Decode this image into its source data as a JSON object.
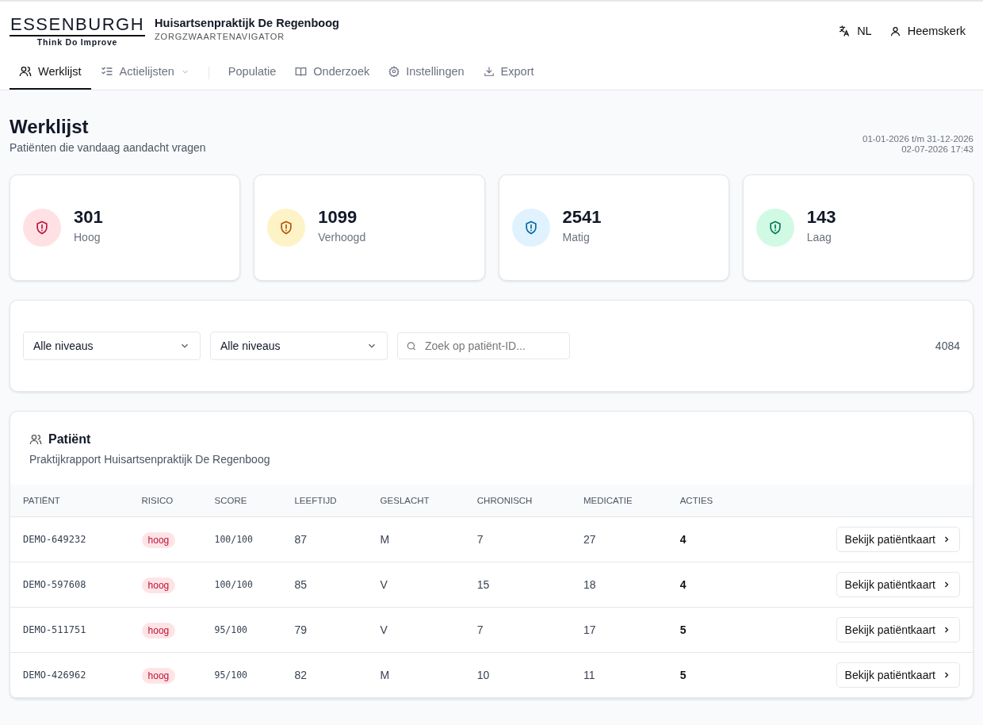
{
  "brand": {
    "logo": "ESSENBURGH",
    "tagline": "Think Do Improve",
    "practice": "Huisartsenpraktijk De Regenboog",
    "app": "ZORGZWAARTENAVIGATOR"
  },
  "header_actions": {
    "language": "NL",
    "user": "Heemskerk"
  },
  "tabs": [
    {
      "label": "Werklijst",
      "selected": true,
      "has_menu": false
    },
    {
      "label": "Actielijsten",
      "selected": false,
      "has_menu": true
    },
    {
      "label": "Populatie",
      "selected": false,
      "has_menu": false
    },
    {
      "label": "Onderzoek",
      "selected": false,
      "has_menu": false
    },
    {
      "label": "Instellingen",
      "selected": false,
      "has_menu": false
    },
    {
      "label": "Export",
      "selected": false,
      "has_menu": false
    }
  ],
  "page": {
    "title": "Werklijst",
    "subtitle": "Patiënten die vandaag aandacht vragen",
    "period": "01-01-2026 t/m 31-12-2026",
    "updated": "02-07-2026 17:43"
  },
  "stats": [
    {
      "value": "301",
      "label": "Hoog",
      "kind": "high"
    },
    {
      "value": "1099",
      "label": "Verhoogd",
      "kind": "elevated"
    },
    {
      "value": "2541",
      "label": "Matig",
      "kind": "moderate"
    },
    {
      "value": "143",
      "label": "Laag",
      "kind": "low"
    }
  ],
  "filters": {
    "selects": [
      "Alle niveaus",
      "Alle niveaus"
    ],
    "search": {
      "placeholder": "Zoek op patiënt-ID..."
    },
    "count": "4084"
  },
  "table": {
    "title": "Patiënt",
    "subtitle": "Praktijkrapport Huisartsenpraktijk De Regenboog",
    "columns": [
      "PATIËNT",
      "RISICO",
      "SCORE",
      "LEEFTIJD",
      "GESLACHT",
      "CHRONISCH",
      "MEDICATIE",
      "ACTIES"
    ],
    "rows": [
      {
        "id": "DEMO-649232",
        "risk": {
          "label": "hoog",
          "kind": "high"
        },
        "score": "100/100",
        "age": "87",
        "sex": "M",
        "chronic": "7",
        "medication": "27",
        "actions": "4",
        "button": "Bekijk patiëntkaart"
      },
      {
        "id": "DEMO-597608",
        "risk": {
          "label": "hoog",
          "kind": "high"
        },
        "score": "100/100",
        "age": "85",
        "sex": "V",
        "chronic": "15",
        "medication": "18",
        "actions": "4",
        "button": "Bekijk patiëntkaart"
      },
      {
        "id": "DEMO-511751",
        "risk": {
          "label": "hoog",
          "kind": "high"
        },
        "score": "95/100",
        "age": "79",
        "sex": "V",
        "chronic": "7",
        "medication": "17",
        "actions": "5",
        "button": "Bekijk patiëntkaart"
      },
      {
        "id": "DEMO-426962",
        "risk": {
          "label": "hoog",
          "kind": "high"
        },
        "score": "95/100",
        "age": "82",
        "sex": "M",
        "chronic": "10",
        "medication": "11",
        "actions": "5",
        "button": "Bekijk patiëntkaart"
      }
    ]
  }
}
